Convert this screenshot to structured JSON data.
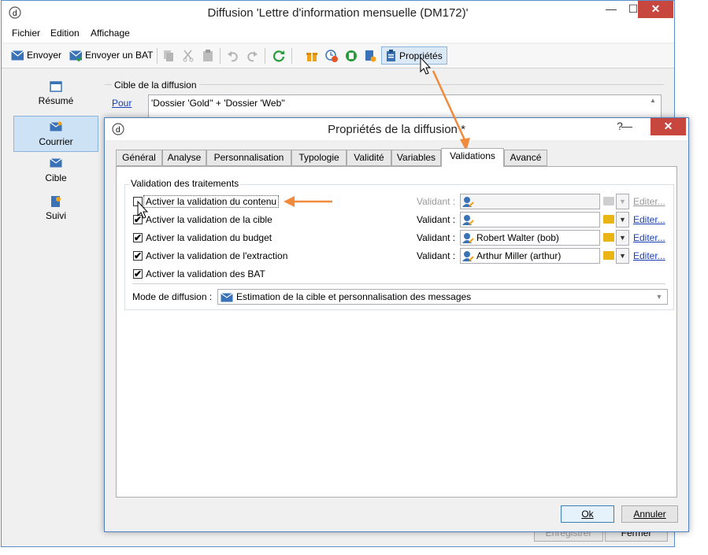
{
  "main_window": {
    "title": "Diffusion 'Lettre d'information mensuelle (DM172)'",
    "minimize": "—",
    "maximize": "☐",
    "close": "✕",
    "menu": [
      "Fichier",
      "Edition",
      "Affichage"
    ],
    "toolbar": {
      "send": "Envoyer",
      "send_proof": "Envoyer un BAT",
      "properties": "Propriétés"
    },
    "sidebar": [
      "Résumé",
      "Courrier",
      "Cible",
      "Suivi"
    ],
    "target_section": {
      "legend": "Cible de la diffusion",
      "for_link": "Pour",
      "for_value": "'Dossier 'Gold'' + 'Dossier 'Web''"
    },
    "footer_hidden_button": "Enregistrer",
    "footer_hidden_close": "Fermer"
  },
  "dialog": {
    "title": "Propriétés de la diffusion *",
    "close": "✕",
    "tabs": [
      "Général",
      "Analyse",
      "Personnalisation",
      "Typologie",
      "Validité",
      "Variables",
      "Validations",
      "Avancé"
    ],
    "active_tab": "Validations",
    "group_title": "Validation des traitements",
    "validations": [
      {
        "label": "Activer la validation du contenu",
        "checked": false,
        "validant_label": "Validant :",
        "validant_value": "",
        "edit": "Editer..."
      },
      {
        "label": "Activer la validation de la cible",
        "checked": true,
        "validant_label": "Validant :",
        "validant_value": "",
        "edit": "Editer..."
      },
      {
        "label": "Activer la validation du budget",
        "checked": true,
        "validant_label": "Validant :",
        "validant_value": "Robert Walter (bob)",
        "edit": "Editer..."
      },
      {
        "label": "Activer la validation de l'extraction",
        "checked": true,
        "validant_label": "Validant :",
        "validant_value": "Arthur Miller (arthur)",
        "edit": "Editer..."
      },
      {
        "label": "Activer la validation des BAT",
        "checked": true
      }
    ],
    "mode_label": "Mode de diffusion :",
    "mode_value": "Estimation de la cible et personnalisation des messages",
    "ok_button": "Ok",
    "cancel_button": "Annuler",
    "check_mark": "✔",
    "dropdown_arrow": "▼"
  },
  "colors": {
    "accent": "#3a72b8",
    "link": "#1a40b5",
    "annotation_arrow": "#f08a3c",
    "close_red": "#c7463e"
  }
}
